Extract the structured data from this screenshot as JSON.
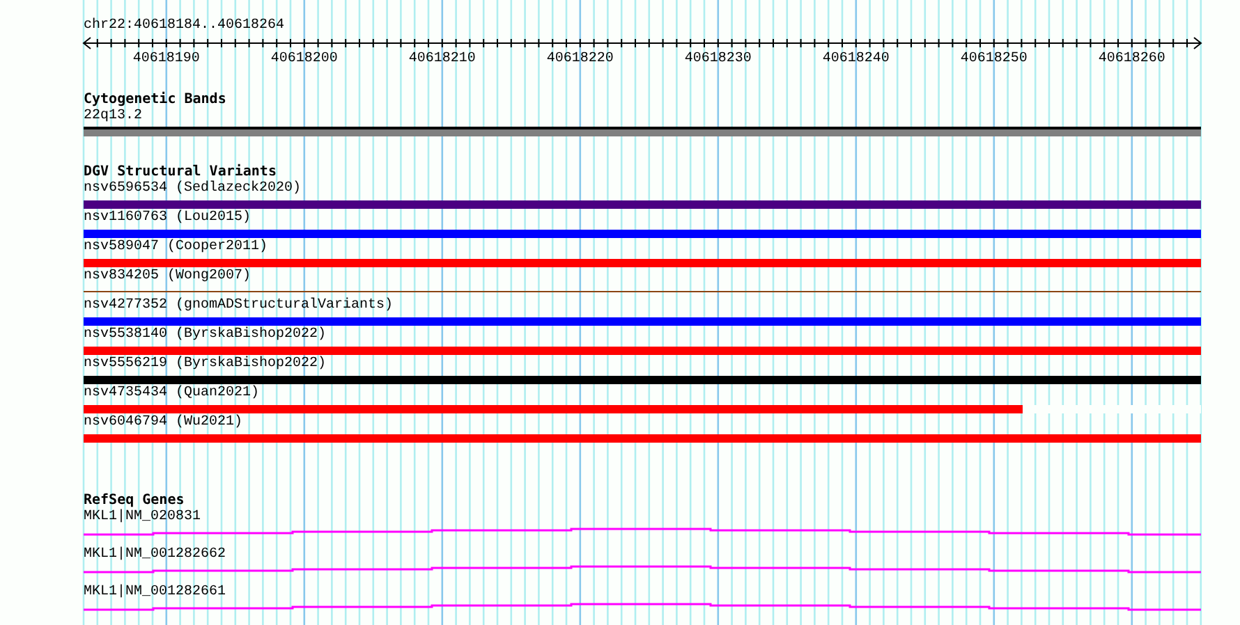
{
  "location": "chr22:40618184..40618264",
  "ruler": {
    "tick_labels": [
      "40618190",
      "40618200",
      "40618210",
      "40618220",
      "40618230",
      "40618240",
      "40618250",
      "40618260"
    ]
  },
  "cytogenetic_bands": {
    "title": "Cytogenetic Bands",
    "band": "22q13.2"
  },
  "dgv_structural_variants": {
    "title": "DGV Structural Variants",
    "variants": [
      {
        "label": "nsv6596534 (Sedlazeck2020)",
        "kind": "bar",
        "color": "#4b0082"
      },
      {
        "label": "nsv1160763 (Lou2015)",
        "kind": "bar",
        "color": "#0000ff"
      },
      {
        "label": "nsv589047 (Cooper2011)",
        "kind": "bar",
        "color": "#ff0000"
      },
      {
        "label": "nsv834205 (Wong2007)",
        "kind": "line",
        "color": "#8b4513"
      },
      {
        "label": "nsv4277352 (gnomADStructuralVariants)",
        "kind": "bar",
        "color": "#0000ff"
      },
      {
        "label": "nsv5538140 (ByrskaBishop2022)",
        "kind": "bar",
        "color": "#ff0000"
      },
      {
        "label": "nsv5556219 (ByrskaBishop2022)",
        "kind": "bar",
        "color": "#000000"
      },
      {
        "label": "nsv4735434 (Quan2021)",
        "kind": "bar",
        "color": "#ff0000",
        "level": 0.84
      },
      {
        "label": "nsv6046794 (Wu2021)",
        "kind": "bar",
        "color": "#ff0000"
      }
    ]
  },
  "refseq_genes": {
    "title": "RefSeq Genes",
    "transcripts": [
      {
        "label": "MKL1|NM_020831"
      },
      {
        "label": "MKL1|NM_001282662"
      },
      {
        "label": "MKL1|NM_001282661"
      }
    ]
  }
}
